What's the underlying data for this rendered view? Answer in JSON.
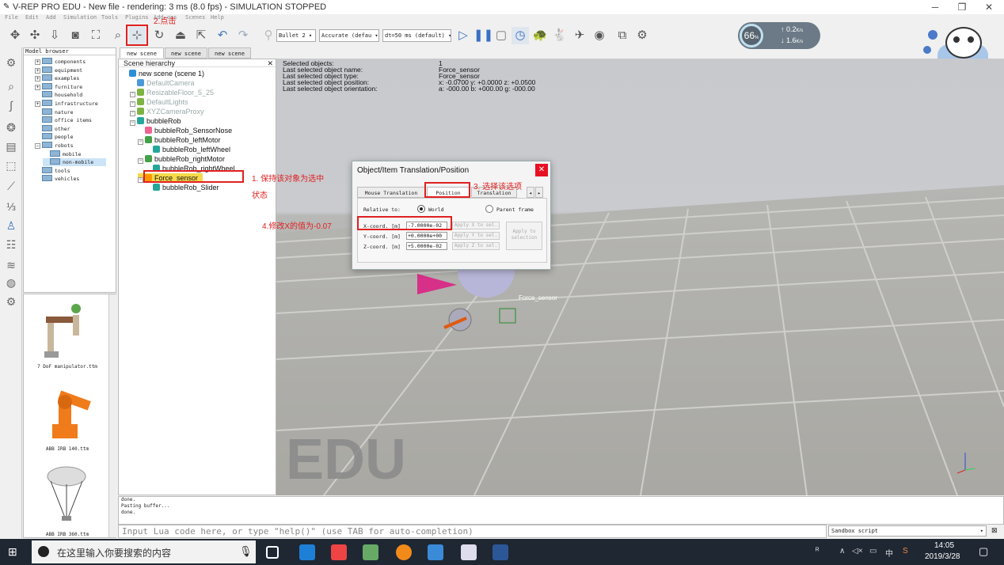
{
  "window": {
    "title": "V-REP PRO EDU - New file - rendering: 3 ms (8.0 fps) - SIMULATION STOPPED",
    "minimize": "─",
    "maximize": "❐",
    "close": "✕"
  },
  "menu": [
    "File",
    "Edit",
    "Add",
    "Simulation",
    "Tools",
    "Plugins",
    "Add-ons",
    "Scenes",
    "Help"
  ],
  "toolbar": {
    "engine": "Bullet 2",
    "accuracy": "Accurate (defau",
    "timestep": "dt=50 ms (default)"
  },
  "perf": {
    "percent": "66",
    "percent_unit": "%",
    "up": "0.2",
    "up_unit": "K/s",
    "down": "1.6",
    "down_unit": "K/s"
  },
  "model_browser": {
    "title": "Model browser",
    "items": [
      {
        "label": "components",
        "indent": 1,
        "toggle": "+"
      },
      {
        "label": "equipment",
        "indent": 1,
        "toggle": "+"
      },
      {
        "label": "examples",
        "indent": 1,
        "toggle": "+"
      },
      {
        "label": "furniture",
        "indent": 1,
        "toggle": "+"
      },
      {
        "label": "household",
        "indent": 1,
        "toggle": ""
      },
      {
        "label": "infrastructure",
        "indent": 1,
        "toggle": "+"
      },
      {
        "label": "nature",
        "indent": 1,
        "toggle": ""
      },
      {
        "label": "office items",
        "indent": 1,
        "toggle": ""
      },
      {
        "label": "other",
        "indent": 1,
        "toggle": ""
      },
      {
        "label": "people",
        "indent": 1,
        "toggle": ""
      },
      {
        "label": "robots",
        "indent": 1,
        "toggle": "−"
      },
      {
        "label": "mobile",
        "indent": 2,
        "toggle": ""
      },
      {
        "label": "non-mobile",
        "indent": 2,
        "toggle": "",
        "selected": true
      },
      {
        "label": "tools",
        "indent": 1,
        "toggle": ""
      },
      {
        "label": "vehicles",
        "indent": 1,
        "toggle": ""
      }
    ]
  },
  "thumbnails": [
    "7 DoF manipulator.ttm",
    "ABB IRB 140.ttm",
    "ABB IRB 360.ttm"
  ],
  "scene_tabs": [
    "new scene",
    "new scene",
    "new scene"
  ],
  "hierarchy": {
    "title": "Scene hierarchy",
    "rows": [
      {
        "label": "new scene (scene 1)",
        "indent": 0,
        "icon": "#2a8fd6",
        "dim": false,
        "toggle": ""
      },
      {
        "label": "DefaultCamera",
        "indent": 1,
        "icon": "#4a9ad8",
        "dim": true,
        "toggle": ""
      },
      {
        "label": "ResizableFloor_5_25",
        "indent": 1,
        "icon": "#7cb342",
        "dim": true,
        "toggle": "+"
      },
      {
        "label": "DefaultLights",
        "indent": 1,
        "icon": "#7cb342",
        "dim": true,
        "toggle": "+"
      },
      {
        "label": "XYZCameraProxy",
        "indent": 1,
        "icon": "#7cb342",
        "dim": true,
        "toggle": "+"
      },
      {
        "label": "bubbleRob",
        "indent": 1,
        "icon": "#26a69a",
        "dim": false,
        "toggle": "−"
      },
      {
        "label": "bubbleRob_SensorNose",
        "indent": 2,
        "icon": "#f06292",
        "dim": false,
        "toggle": ""
      },
      {
        "label": "bubbleRob_leftMotor",
        "indent": 2,
        "icon": "#43a047",
        "dim": false,
        "toggle": "−"
      },
      {
        "label": "bubbleRob_leftWheel",
        "indent": 3,
        "icon": "#26a69a",
        "dim": false,
        "toggle": ""
      },
      {
        "label": "bubbleRob_rightMotor",
        "indent": 2,
        "icon": "#43a047",
        "dim": false,
        "toggle": "−"
      },
      {
        "label": "bubbleRob_rightWheel",
        "indent": 3,
        "icon": "#26a69a",
        "dim": false,
        "toggle": ""
      },
      {
        "label": "Force_sensor",
        "indent": 2,
        "icon": "#ff9800",
        "dim": false,
        "toggle": "−",
        "selected": true
      },
      {
        "label": "bubbleRob_Slider",
        "indent": 3,
        "icon": "#26a69a",
        "dim": false,
        "toggle": ""
      }
    ]
  },
  "selection_info": {
    "labels": [
      "Selected objects:",
      "Last selected object name:",
      "Last selected object type:",
      "Last selected object position:",
      "Last selected object orientation:"
    ],
    "values": [
      "1",
      "Force_sensor",
      "Force_sensor",
      "x: -0.0700    y: +0.0000    z: +0.0500",
      "a: -000.00    b: +000.00    g: -000.00"
    ]
  },
  "dialog": {
    "title": "Object/Item Translation/Position",
    "tabs": [
      "Mouse Translation",
      "Position",
      "Translation"
    ],
    "relative_to": "Relative to:",
    "world": "World",
    "parent": "Parent frame",
    "x_label": "X-coord. [m]",
    "x_value": "-7.0000e-02",
    "x_apply": "Apply X to sel.",
    "y_label": "Y-coord. [m]",
    "y_value": "+0.0000e+00",
    "y_apply": "Apply Y to sel.",
    "z_label": "Z-coord. [m]",
    "z_value": "+5.0000e-02",
    "z_apply": "Apply Z to sel.",
    "apply_all": "Apply to selection"
  },
  "annotations": {
    "a1": "1. 保持该对象为选中",
    "a1b": "状态",
    "a2": "2.点击",
    "a3": "3. 选择该选项",
    "a4": "4.修改X的值为-0.07"
  },
  "viewport": {
    "object_label": "Force_sensor",
    "watermark": "EDU"
  },
  "console": [
    "done.",
    "Pasting buffer...",
    "done."
  ],
  "command": {
    "placeholder": "Input Lua code here, or type \"help()\" (use TAB for auto-completion)",
    "script": "Sandbox script"
  },
  "taskbar": {
    "search": "在这里输入你要搜索的内容",
    "time": "14:05",
    "date": "2019/3/28",
    "ime": "中"
  }
}
